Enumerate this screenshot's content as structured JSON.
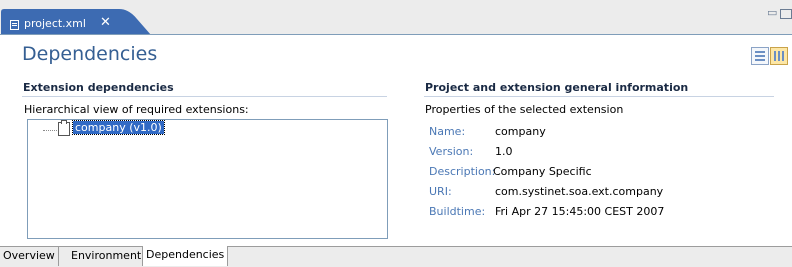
{
  "tab": {
    "title": "project.xml",
    "close": "✕",
    "icon": "file-icon"
  },
  "window": {
    "minimize": "▭",
    "maximize": ""
  },
  "header": {
    "title": "Dependencies"
  },
  "left": {
    "heading": "Extension dependencies",
    "description": "Hierarchical view of required extensions:",
    "tree": [
      {
        "label": "company (v1.0)",
        "selected": true,
        "icon": "package-icon"
      }
    ]
  },
  "right": {
    "heading": "Project and extension general information",
    "description": "Properties of the selected extension",
    "properties": [
      {
        "key": "Name:",
        "value": "company"
      },
      {
        "key": "Version:",
        "value": "1.0"
      },
      {
        "key": "Description:",
        "value": "Company Specific"
      },
      {
        "key": "URI:",
        "value": "com.systinet.soa.ext.company"
      },
      {
        "key": "Buildtime:",
        "value": "Fri Apr 27 15:45:00 CEST 2007"
      }
    ]
  },
  "bottom_tabs": [
    {
      "label": "Overview",
      "active": false
    },
    {
      "label": "Environment",
      "active": false
    },
    {
      "label": "Dependencies",
      "active": true
    }
  ],
  "colors": {
    "tab_active": "#3d6bb2",
    "title": "#355f93",
    "selection": "#316ac5",
    "property_key": "#4b78b5"
  }
}
